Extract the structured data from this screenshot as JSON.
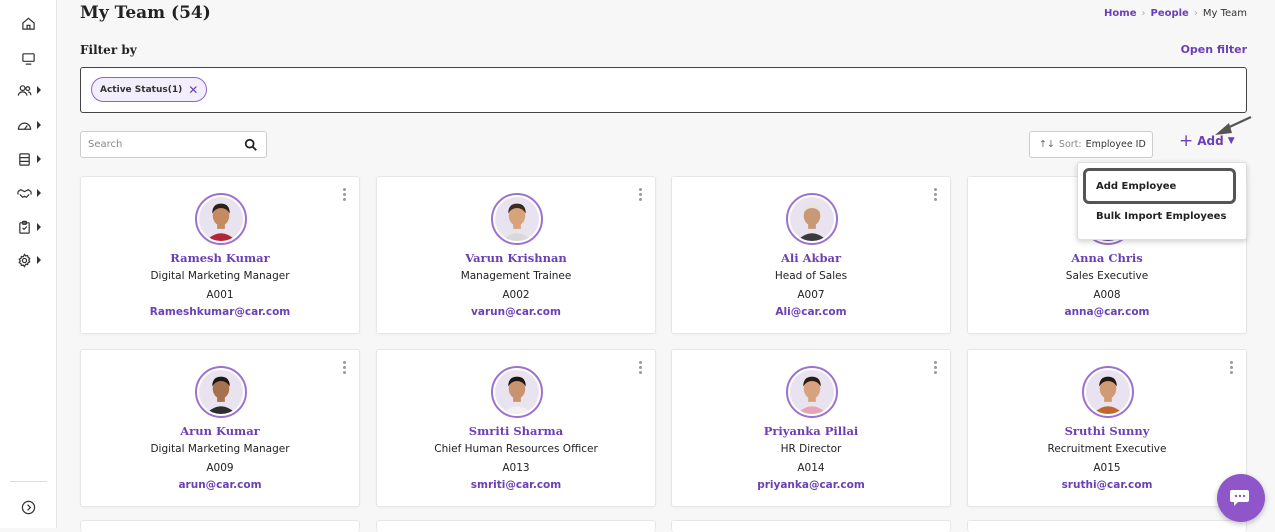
{
  "header": {
    "title": "My Team (54)",
    "breadcrumb": {
      "home": "Home",
      "people": "People",
      "current": "My Team",
      "sep": "›"
    }
  },
  "filter": {
    "label": "Filter by",
    "open_label": "Open filter",
    "chips": [
      {
        "label": "Active Status(1)",
        "remove": "✕"
      }
    ]
  },
  "toolbar": {
    "search_placeholder": "Search",
    "sort_icon": "↑↓",
    "sort_label": "Sort:",
    "sort_value": "Employee ID",
    "add_label": "Add",
    "add_chevron": "⌄"
  },
  "add_menu": {
    "items": [
      "Add Employee",
      "Bulk Import Employees"
    ]
  },
  "employees": [
    {
      "name": "Ramesh Kumar",
      "role": "Digital Marketing Manager",
      "id": "A001",
      "email": "Rameshkumar@car.com",
      "skin": "#c48a62",
      "hair": "#2b2119",
      "shirt": "#b3263a"
    },
    {
      "name": "Varun Krishnan",
      "role": "Management Trainee",
      "id": "A002",
      "email": "varun@car.com",
      "skin": "#d6a37b",
      "hair": "#3a2c20",
      "shirt": "#d8d8d8"
    },
    {
      "name": "Ali Akbar",
      "role": "Head of Sales",
      "id": "A007",
      "email": "Ali@car.com",
      "skin": "#c99876",
      "hair": "#e8e4dc",
      "shirt": "#3a3a3a"
    },
    {
      "name": "Anna Chris",
      "role": "Sales Executive",
      "id": "A008",
      "email": "anna@car.com",
      "skin": "#d9ad8a",
      "hair": "#3b2a1f",
      "shirt": "#6b4a8a"
    },
    {
      "name": "Arun Kumar",
      "role": "Digital Marketing Manager",
      "id": "A009",
      "email": "arun@car.com",
      "skin": "#a8714d",
      "hair": "#1e1712",
      "shirt": "#2d2d30"
    },
    {
      "name": "Smriti Sharma",
      "role": "Chief Human Resources Officer",
      "id": "A013",
      "email": "smriti@car.com",
      "skin": "#c99370",
      "hair": "#1d1612",
      "shirt": "#f1f1f1"
    },
    {
      "name": "Priyanka Pillai",
      "role": "HR Director",
      "id": "A014",
      "email": "priyanka@car.com",
      "skin": "#d7a280",
      "hair": "#2a1c14",
      "shirt": "#e8a4b3"
    },
    {
      "name": "Sruthi Sunny",
      "role": "Recruitment Executive",
      "id": "A015",
      "email": "sruthi@car.com",
      "skin": "#cf9a74",
      "hair": "#241812",
      "shirt": "#c0662e"
    }
  ],
  "colors": {
    "accent": "#6b3fb5",
    "avatar_ring": "#9b72cf",
    "chat_fab": "#8e56c9"
  },
  "icons": {
    "sidebar": [
      "home-icon",
      "monitor-icon",
      "people-icon",
      "gauge-icon",
      "database-icon",
      "handshake-icon",
      "clipboard-icon",
      "settings-icon",
      "expand-icon"
    ]
  }
}
